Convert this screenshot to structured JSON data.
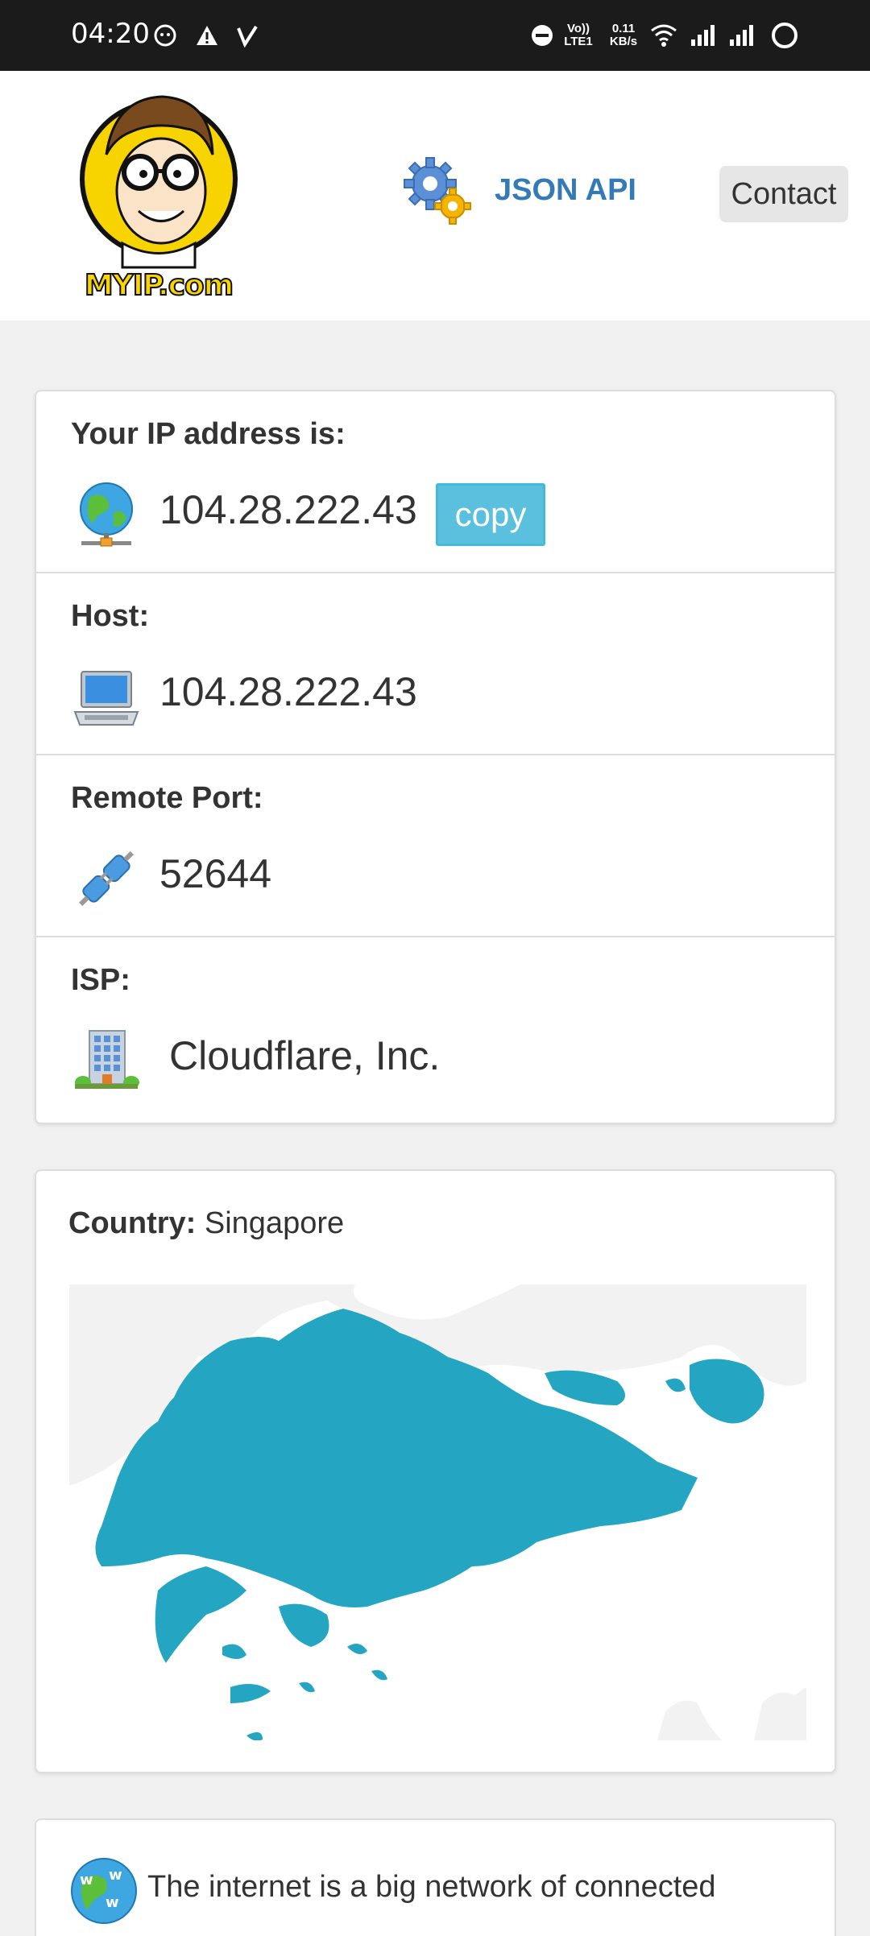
{
  "status_bar": {
    "time": "04:20",
    "volte": "Vo)) LTE1",
    "speed_value": "0.11",
    "speed_unit": "KB/s"
  },
  "header": {
    "logo_text": "MYIP.com",
    "api_label": "JSON API",
    "contact_label": "Contact"
  },
  "ip_card": {
    "ip_label": "Your IP address is:",
    "ip_value": "104.28.222.43",
    "copy_label": "copy",
    "host_label": "Host:",
    "host_value": "104.28.222.43",
    "port_label": "Remote Port:",
    "port_value": "52644",
    "isp_label": "ISP:",
    "isp_value": "Cloudflare, Inc."
  },
  "country_card": {
    "country_label": "Country:",
    "country_value": "Singapore",
    "map_color": "#24a5c2"
  },
  "info_card": {
    "text": "The internet is a big network of connected"
  },
  "colors": {
    "accent_link": "#337ab7",
    "copy_button": "#5bc0de"
  }
}
